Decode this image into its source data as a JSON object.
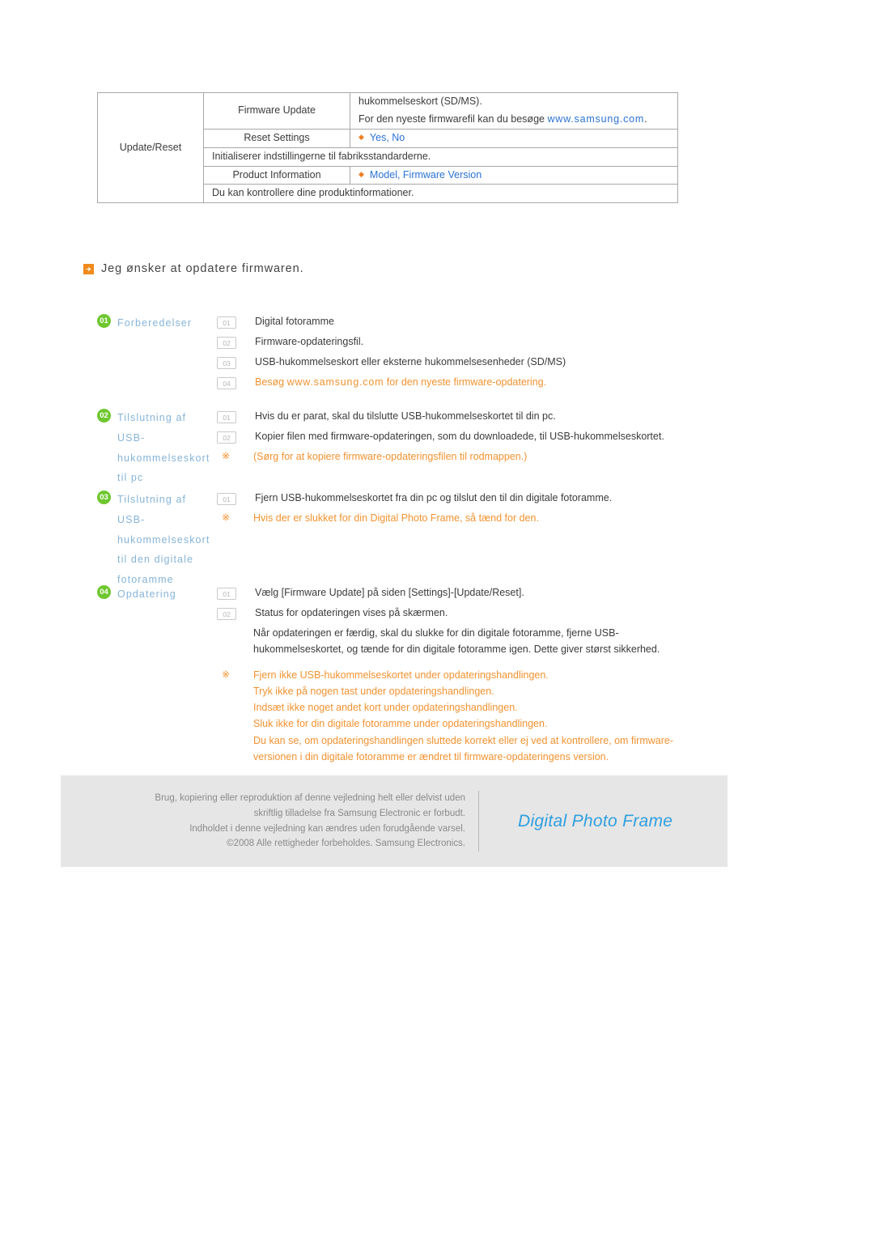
{
  "settings_table": {
    "group_label": "Update/Reset",
    "rows": [
      {
        "type": "split",
        "name": "Firmware Update",
        "value_lines": [
          {
            "text": "hukommelseskort (SD/MS)."
          },
          {
            "prefix": "For den nyeste firmwarefil kan du besøge ",
            "link": "www.samsung.com",
            "suffix": "."
          }
        ]
      },
      {
        "type": "split",
        "name": "Reset Settings",
        "bullet": "◆",
        "options": "Yes, No"
      },
      {
        "type": "full",
        "text": "Initialiserer indstillingerne til fabriksstandarderne."
      },
      {
        "type": "split",
        "name": "Product Information",
        "bullet": "◆",
        "options": "Model, Firmware Version"
      },
      {
        "type": "full",
        "text": "Du kan kontrollere dine produktinformationer."
      }
    ]
  },
  "section": {
    "icon": "arrow-right-icon",
    "title": "Jeg ønsker at opdatere firmwaren."
  },
  "procedures": [
    {
      "badge": "01",
      "label": "Forberedelser",
      "steps": [
        {
          "num": "01",
          "text": "Digital fotoramme"
        },
        {
          "num": "02",
          "text": "Firmware-opdateringsfil."
        },
        {
          "num": "03",
          "text": "USB-hukommelseskort eller eksterne hukommelsesenheder (SD/MS)"
        },
        {
          "num": "04",
          "orange": true,
          "prefix": "Besøg ",
          "url": "www.samsung.com",
          "suffix": " for den nyeste firmware-opdatering."
        }
      ]
    },
    {
      "badge": "02",
      "label": "Tilslutning af USB-hukommelseskort til pc",
      "steps": [
        {
          "num": "01",
          "text": "Hvis du er parat, skal du tilslutte USB-hukommelseskortet til din pc."
        },
        {
          "num": "02",
          "text": "Kopier filen med firmware-opdateringen, som du downloadede, til USB-hukommelseskortet."
        },
        {
          "mark": "※",
          "orange": true,
          "text": "(Sørg for at kopiere firmware-opdateringsfilen til rodmappen.)"
        }
      ]
    },
    {
      "badge": "03",
      "label": "Tilslutning af USB-hukommelseskort til den digitale fotoramme",
      "steps": [
        {
          "num": "01",
          "text": "Fjern USB-hukommelseskortet fra din pc og tilslut den til din digitale fotoramme."
        },
        {
          "mark": "※",
          "orange": true,
          "text": "Hvis der er slukket for din Digital Photo Frame, så tænd for den."
        }
      ]
    },
    {
      "badge": "04",
      "label": "Opdatering",
      "steps": [
        {
          "num": "01",
          "text": "Vælg [Firmware Update] på siden [Settings]-[Update/Reset]."
        },
        {
          "num": "02",
          "text": "Status for opdateringen vises på skærmen."
        }
      ],
      "continuation": [
        "Når opdateringen er færdig, skal du slukke for din digitale fotoramme, fjerne USB-",
        "hukommelseskortet, og tænde for din digitale fotoramme igen. Dette giver størst sikkerhed."
      ],
      "warnings": {
        "mark": "※",
        "lines": [
          "Fjern ikke USB-hukommelseskortet under opdateringshandlingen.",
          "Tryk ikke på nogen tast under opdateringshandlingen.",
          "Indsæt ikke noget andet kort under opdateringshandlingen.",
          "Sluk ikke for din digitale fotoramme under opdateringshandlingen.",
          "Du kan se, om opdateringshandlingen sluttede korrekt eller ej ved at kontrollere, om firmware-",
          "versionen i din digitale fotoramme er ændret til firmware-opdateringens version."
        ]
      }
    }
  ],
  "footer": {
    "copyright_lines": [
      "Brug, kopiering eller reproduktion af denne vejledning helt eller delvist uden",
      "skriftlig tilladelse fra Samsung Electronic er forbudt.",
      "Indholdet i denne vejledning kan ændres uden forudgående varsel.",
      "©2008 Alle rettigheder forbeholdes. Samsung Electronics."
    ],
    "brand": "Digital Photo Frame"
  },
  "colors": {
    "orange": "#f2922f",
    "green_badge": "#6ec72e",
    "label_blue": "#86b4d8",
    "link_blue": "#2a72d4",
    "brand_blue": "#2f9fe0",
    "footer_bg": "#e6e6e6"
  }
}
